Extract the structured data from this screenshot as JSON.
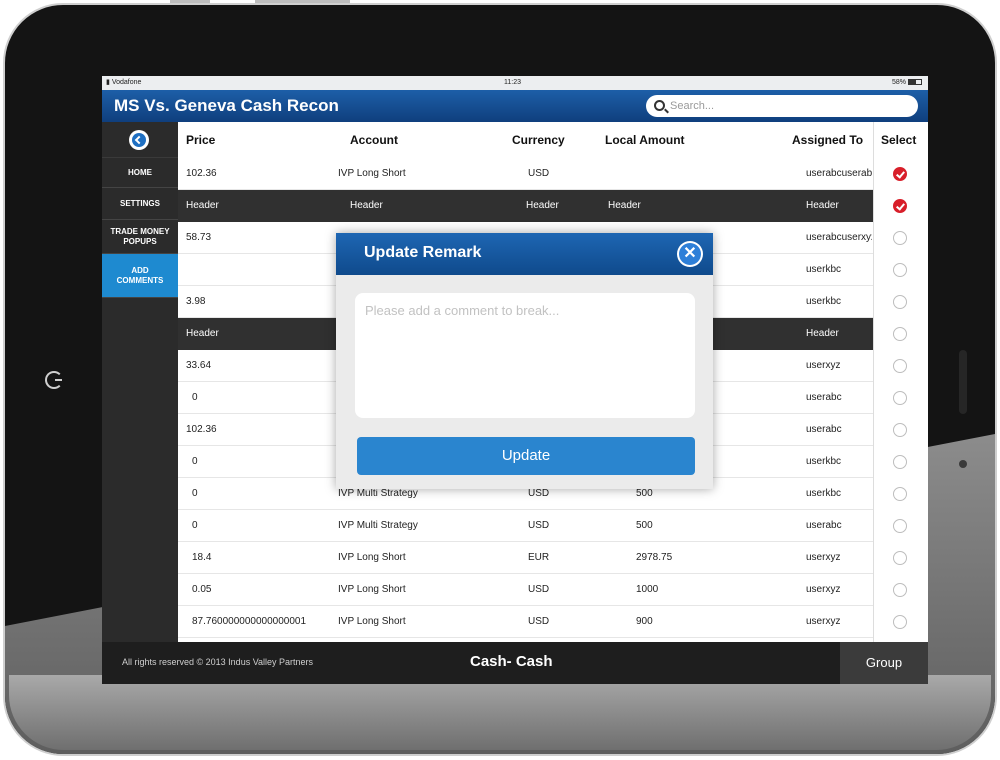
{
  "statusbar": {
    "carrier": "Vodafone",
    "time": "11:23",
    "battery": "58%"
  },
  "app": {
    "title": "MS Vs. Geneva Cash Recon"
  },
  "search": {
    "placeholder": "Search..."
  },
  "sidebar": {
    "items": [
      {
        "label": "HOME",
        "active": false
      },
      {
        "label": "SETTINGS",
        "active": false
      },
      {
        "label": "TRADE MONEY POPUPS",
        "active": false
      },
      {
        "label": "ADD COMMENTS",
        "active": true
      }
    ]
  },
  "table": {
    "columns": [
      "Price",
      "Account",
      "Currency",
      "Local Amount",
      "Assigned To",
      "Select"
    ],
    "rows": [
      {
        "type": "data",
        "price": "102.36",
        "account": "IVP Long Short",
        "currency": "USD",
        "amount": "",
        "assigned": "userabcuserabcuserabc",
        "selected": true
      },
      {
        "type": "header",
        "price": "Header",
        "account": "Header",
        "currency": "Header",
        "amount": "Header",
        "assigned": "Header",
        "selected": true
      },
      {
        "type": "data",
        "price": "58.73",
        "account": "",
        "currency": "",
        "amount": "",
        "assigned": "userabcuserxyz",
        "selected": false
      },
      {
        "type": "data",
        "price": "",
        "account": "",
        "currency": "",
        "amount": "",
        "assigned": "userkbc",
        "selected": false
      },
      {
        "type": "data",
        "price": "3.98",
        "account": "",
        "currency": "",
        "amount": "",
        "assigned": "userkbc",
        "selected": false
      },
      {
        "type": "header",
        "price": "Header",
        "account": "",
        "currency": "",
        "amount": "",
        "assigned": "Header",
        "selected": false
      },
      {
        "type": "data",
        "price": "33.64",
        "account": "",
        "currency": "",
        "amount": "",
        "assigned": "userxyz",
        "selected": false
      },
      {
        "type": "data",
        "price": "0",
        "account": "",
        "currency": "",
        "amount": "",
        "assigned": "userabc",
        "selected": false
      },
      {
        "type": "data",
        "price": "102.36",
        "account": "",
        "currency": "",
        "amount": "",
        "assigned": "userabc",
        "selected": false
      },
      {
        "type": "data",
        "price": "0",
        "account": "",
        "currency": "",
        "amount": "",
        "assigned": "userkbc",
        "selected": false
      },
      {
        "type": "data",
        "price": "0",
        "account": "IVP Multi Strategy",
        "currency": "USD",
        "amount": "500",
        "assigned": "userkbc",
        "selected": false
      },
      {
        "type": "data",
        "price": "0",
        "account": "IVP Multi Strategy",
        "currency": "USD",
        "amount": "500",
        "assigned": "userabc",
        "selected": false
      },
      {
        "type": "data",
        "price": "18.4",
        "account": "IVP Long Short",
        "currency": "EUR",
        "amount": "2978.75",
        "assigned": "userxyz",
        "selected": false
      },
      {
        "type": "data",
        "price": "0.05",
        "account": "IVP Long Short",
        "currency": "USD",
        "amount": "1000",
        "assigned": "userxyz",
        "selected": false
      },
      {
        "type": "data",
        "price": "87.760000000000000001",
        "account": "IVP Long Short",
        "currency": "USD",
        "amount": "900",
        "assigned": "userxyz",
        "selected": false
      }
    ]
  },
  "footer": {
    "copyright": "All rights reserved © 2013 Indus Valley Partners",
    "center": "Cash- Cash",
    "group": "Group"
  },
  "modal": {
    "title": "Update Remark",
    "placeholder": "Please add a comment to break...",
    "button": "Update"
  },
  "colors": {
    "brand_blue": "#0f3f7d",
    "accent_blue": "#1e8ad0",
    "button_blue": "#2a85cf",
    "sidebar_bg": "#2b2b2b",
    "selected_red": "#d81f2a"
  }
}
